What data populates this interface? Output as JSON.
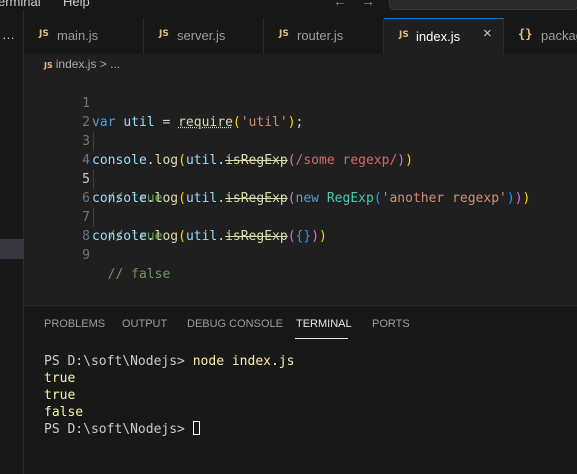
{
  "menubar": {
    "items": [
      "erminal",
      "Help"
    ]
  },
  "tabs": [
    {
      "label": "main.js",
      "icon": "JS"
    },
    {
      "label": "server.js",
      "icon": "JS"
    },
    {
      "label": "router.js",
      "icon": "JS"
    },
    {
      "label": "index.js",
      "icon": "JS",
      "active": true,
      "close": "×"
    },
    {
      "label": "packag",
      "icon": "{}"
    }
  ],
  "breadcrumb": {
    "icon": "JS",
    "file": "index.js",
    "separator": ">",
    "rest": "..."
  },
  "sidebar": {
    "dots": "…"
  },
  "editor": {
    "line_numbers": [
      "1",
      "2",
      "3",
      "4",
      "5",
      "6",
      "7",
      "8",
      "9"
    ],
    "current_line": 5
  },
  "panel": {
    "tabs": [
      "PROBLEMS",
      "OUTPUT",
      "DEBUG CONSOLE",
      "TERMINAL",
      "PORTS"
    ],
    "active_tab": "TERMINAL",
    "terminal": {
      "prompt": "PS D:\\soft\\Nodejs> ",
      "command": "node index.js",
      "output": [
        "true",
        "true",
        "false"
      ],
      "final_prompt": "PS D:\\soft\\Nodejs> "
    }
  },
  "colors": {
    "accent": "#0078d4",
    "js_icon": "#e5c07b",
    "terminal_output": "#f9f1a5"
  }
}
